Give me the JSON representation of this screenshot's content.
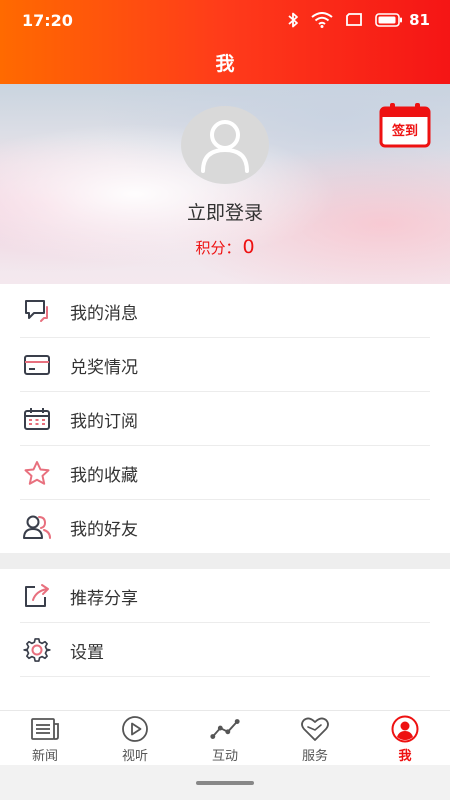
{
  "status_bar": {
    "time": "17:20",
    "battery_level": "81"
  },
  "header": {
    "title": "我"
  },
  "profile": {
    "login_label": "立即登录",
    "points_label": "积分：",
    "points_value": "0",
    "checkin_label": "签到"
  },
  "menu_group1": [
    {
      "label": "我的消息",
      "icon": "message-icon"
    },
    {
      "label": "兑奖情况",
      "icon": "card-icon"
    },
    {
      "label": "我的订阅",
      "icon": "calendar-icon"
    },
    {
      "label": "我的收藏",
      "icon": "star-icon"
    },
    {
      "label": "我的好友",
      "icon": "friends-icon"
    }
  ],
  "menu_group2": [
    {
      "label": "推荐分享",
      "icon": "share-icon"
    },
    {
      "label": "设置",
      "icon": "gear-icon"
    }
  ],
  "tabs": [
    {
      "label": "新闻",
      "icon": "newspaper-icon",
      "active": false
    },
    {
      "label": "视听",
      "icon": "play-icon",
      "active": false
    },
    {
      "label": "互动",
      "icon": "trend-icon",
      "active": false
    },
    {
      "label": "服务",
      "icon": "heart-icon",
      "active": false
    },
    {
      "label": "我",
      "icon": "user-icon",
      "active": true
    }
  ],
  "colors": {
    "accent": "#ee1111",
    "header_start": "#ff6a00",
    "header_end": "#f51515",
    "icon_gray": "#3a3f4b",
    "icon_pink": "#e8707e"
  }
}
